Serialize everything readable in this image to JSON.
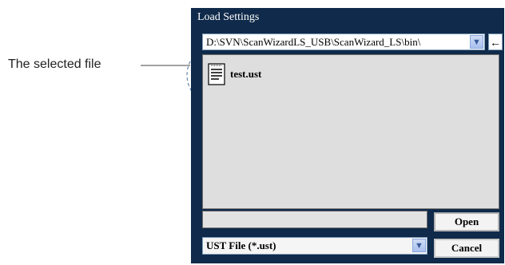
{
  "annotation": {
    "label": "The selected file"
  },
  "dialog": {
    "title": "Load Settings",
    "path": "D:\\SVN\\ScanWizardLS_USB\\ScanWizard_LS\\bin\\",
    "back_glyph": "←",
    "files": [
      {
        "name": "test.ust",
        "icon": "document-icon"
      }
    ],
    "filename_value": "",
    "open_label": "Open",
    "cancel_label": "Cancel",
    "filter_value": "UST File (*.ust)"
  },
  "colors": {
    "titlebar": "#0f2a4a",
    "list_bg": "#dedede"
  }
}
